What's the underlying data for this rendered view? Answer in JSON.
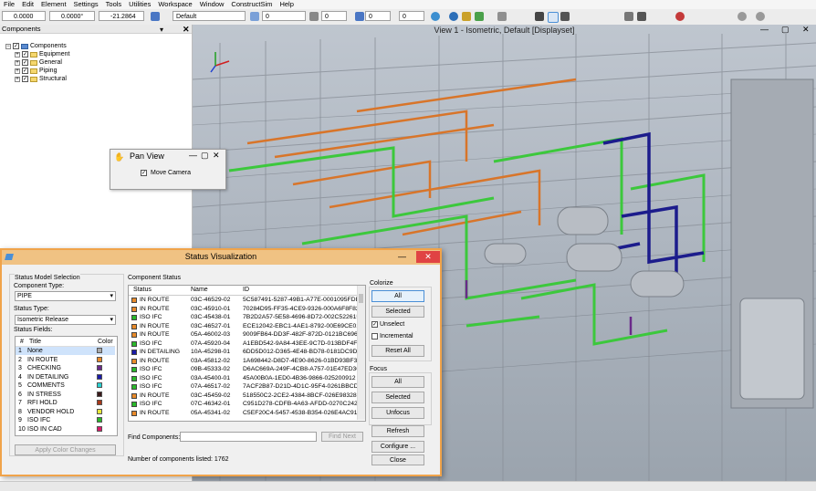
{
  "menubar": {
    "items": [
      "File",
      "Edit",
      "Element",
      "Settings",
      "Tools",
      "Utilities",
      "Workspace",
      "Window",
      "ConstructSim",
      "Help"
    ]
  },
  "toolbar": {
    "field_1": "0.0000",
    "field_2": "0.0000°",
    "field_3": "-21.2864",
    "level_select": "Default",
    "num_1": "0",
    "num_2": "0",
    "num_3": "0",
    "num_4": "0"
  },
  "components_panel": {
    "title": "Components",
    "tree": {
      "root": "Components",
      "children": [
        "Equipment",
        "General",
        "Piping",
        "Structural"
      ]
    }
  },
  "viewport": {
    "title": "View 1 - Isometric, Default [Displayset]"
  },
  "pan_view": {
    "title": "Pan View",
    "move_camera_label": "Move Camera"
  },
  "status_vis": {
    "title": "Status Visualization",
    "model_selection_label": "Status Model Selection",
    "component_type_label": "Component Type:",
    "component_type_value": "PIPE",
    "status_type_label": "Status Type:",
    "status_type_value": "Isometric Release",
    "status_fields_label": "Status Fields:",
    "fields_header": {
      "num": "#",
      "title": "Title",
      "color": "Color"
    },
    "fields": [
      {
        "num": "1",
        "title": "None",
        "color": "#a9a9a9"
      },
      {
        "num": "2",
        "title": "IN  ROUTE",
        "color": "#e88a2a"
      },
      {
        "num": "3",
        "title": "CHECKING",
        "color": "#6a2a8a"
      },
      {
        "num": "4",
        "title": "IN  DETAILING",
        "color": "#1a1aa8"
      },
      {
        "num": "5",
        "title": "COMMENTS",
        "color": "#2ad0d0"
      },
      {
        "num": "6",
        "title": "IN  STRESS",
        "color": "#3a1a1a"
      },
      {
        "num": "7",
        "title": "RFI  HOLD",
        "color": "#a83a1a"
      },
      {
        "num": "8",
        "title": "VENDOR  HOLD",
        "color": "#e8e83a"
      },
      {
        "num": "9",
        "title": "ISO  IFC",
        "color": "#2ab82a"
      },
      {
        "num": "10",
        "title": "ISO  IN  CAD",
        "color": "#d81a6a"
      }
    ],
    "apply_colors_label": "Apply Color Changes",
    "component_status_label": "Component Status",
    "status_header": {
      "status": "Status",
      "name": "Name",
      "id": "ID"
    },
    "rows": [
      {
        "status": "IN  ROUTE",
        "name": "03C-46529-02",
        "id": "5C587491-5287-49B1-A77E-0001095FDE",
        "color": "#e88a2a"
      },
      {
        "status": "IN  ROUTE",
        "name": "03C-45910-01",
        "id": "70284D95-FF35-4CE9-9326-000A6F8F82",
        "color": "#e88a2a"
      },
      {
        "status": "ISO  IFC",
        "name": "03C-45438-01",
        "id": "7B2D2A57-5E58-4696-8D72-002C522615",
        "color": "#2ab82a"
      },
      {
        "status": "IN  ROUTE",
        "name": "03C-46527-01",
        "id": "ECE12042-EBC1-4AE1-8792-00E69CE01",
        "color": "#e88a2a"
      },
      {
        "status": "IN  ROUTE",
        "name": "05A-46002-03",
        "id": "9009FB64-DD3F-482F-872D-0121BC696D",
        "color": "#e88a2a"
      },
      {
        "status": "ISO  IFC",
        "name": "07A-45920-04",
        "id": "A1EBD542-9A84-43EE-9C7D-013BDF4F4",
        "color": "#2ab82a"
      },
      {
        "status": "IN  DETAILING",
        "name": "10A-45298-01",
        "id": "6DD5D012-D365-4E48-BD78-0181DC9D",
        "color": "#1a1aa8"
      },
      {
        "status": "IN  ROUTE",
        "name": "03A-45812-02",
        "id": "1A698442-D8D7-4E90-8626-01BD93BF3",
        "color": "#e88a2a"
      },
      {
        "status": "ISO  IFC",
        "name": "09B-45333-02",
        "id": "D6AC669A-249F-4CB8-A757-01E47ED36",
        "color": "#2ab82a"
      },
      {
        "status": "ISO  IFC",
        "name": "03A-45400-01",
        "id": "45A00B0A-1ED0-4B36-9866-025200912",
        "color": "#2ab82a"
      },
      {
        "status": "ISO  IFC",
        "name": "07A-46517-02",
        "id": "7ACF2B87-D21D-4D1C-95F4-0261BBCD",
        "color": "#2ab82a"
      },
      {
        "status": "IN  ROUTE",
        "name": "03C-45459-02",
        "id": "518550C2-2CE2-4384-8BCF-026E983288",
        "color": "#e88a2a"
      },
      {
        "status": "ISO  IFC",
        "name": "07C-46342-01",
        "id": "C951D278-CDFB-4A63-AFDD-0270C242A",
        "color": "#2ab82a"
      },
      {
        "status": "IN  ROUTE",
        "name": "05A-45341-02",
        "id": "C5EF20C4-5457-4538-B354-026E4AC916",
        "color": "#e88a2a"
      }
    ],
    "find_label": "Find Components:",
    "find_value": "",
    "find_next_label": "Find Next",
    "count_label": "Number of components listed: 1762",
    "colorize_label": "Colorize",
    "all_label": "All",
    "selected_label": "Selected",
    "unselect_label": "Unselect",
    "incremental_label": "Incremental",
    "reset_all_label": "Reset All",
    "focus_label": "Focus",
    "focus_all_label": "All",
    "focus_selected_label": "Selected",
    "unfocus_label": "Unfocus",
    "refresh_label": "Refresh",
    "configure_label": "Configure ...",
    "close_label": "Close"
  }
}
